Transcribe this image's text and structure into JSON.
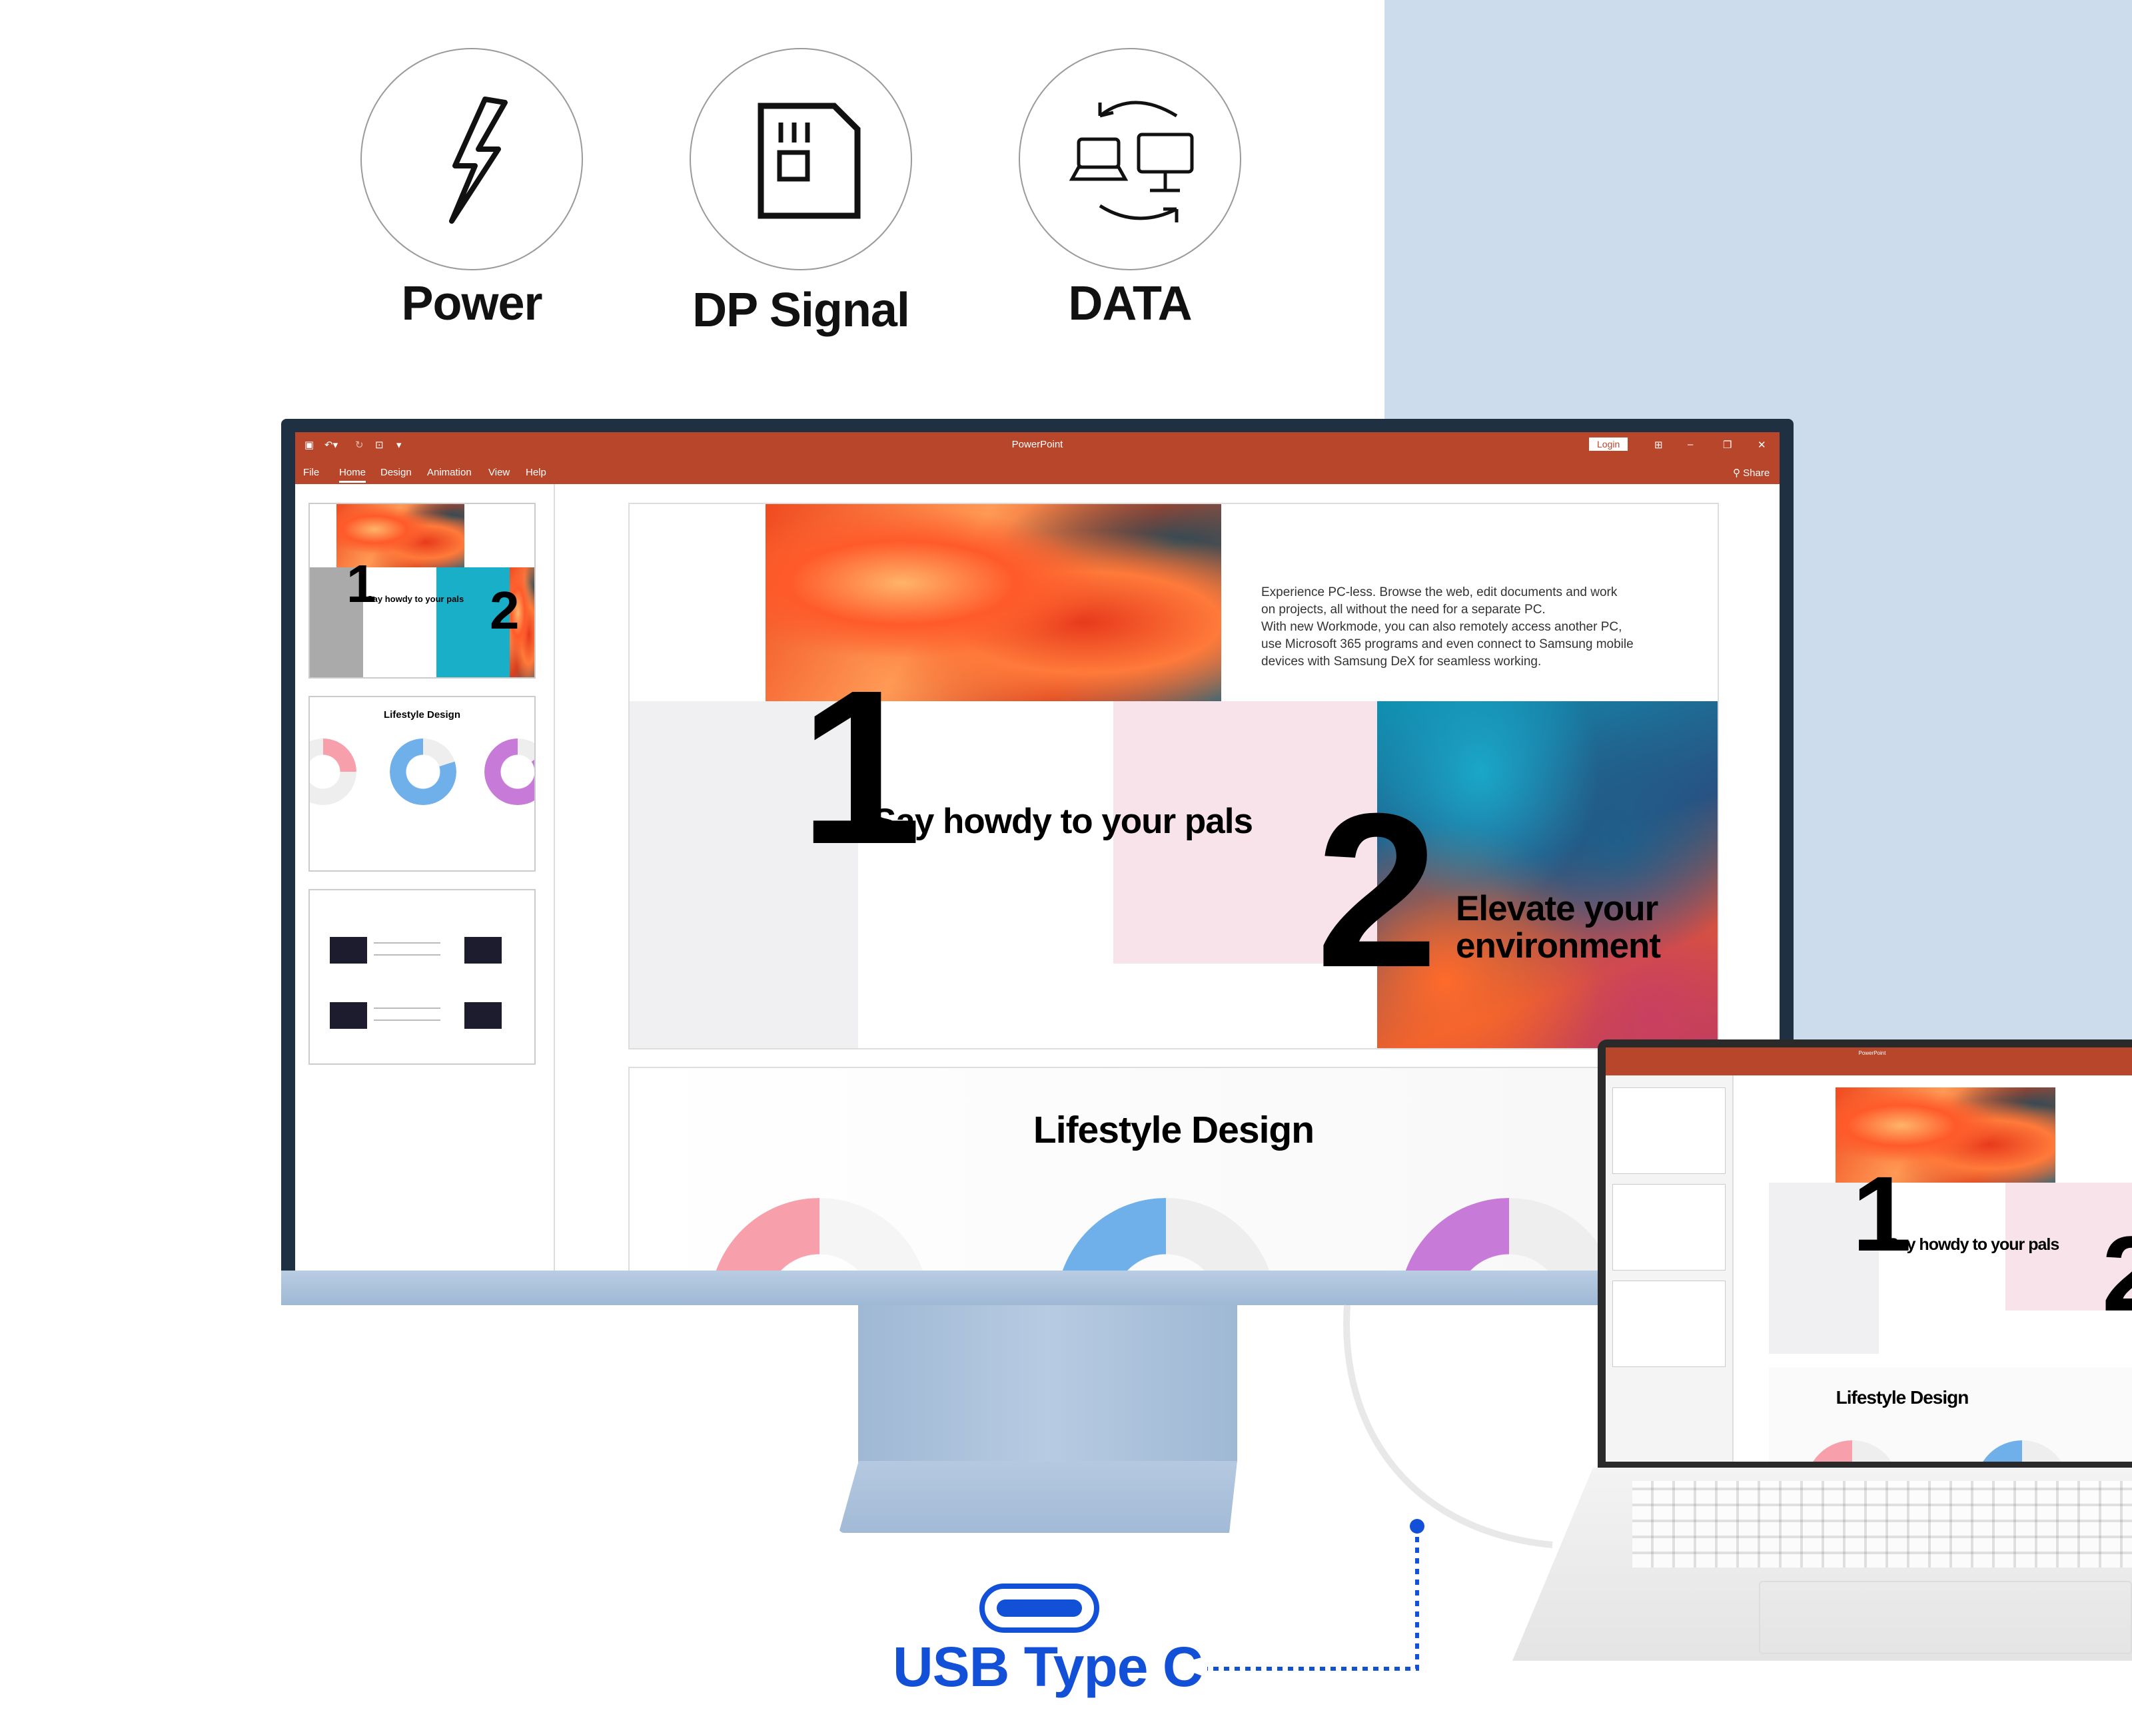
{
  "features": [
    {
      "label": "Power",
      "icon": "lightning-bolt-icon"
    },
    {
      "label": "DP Signal",
      "icon": "sd-card-icon"
    },
    {
      "label": "DATA",
      "icon": "device-sync-icon"
    }
  ],
  "app": {
    "title": "PowerPoint",
    "login_label": "Login",
    "share_label": "Share",
    "menu": [
      "File",
      "Home",
      "Design",
      "Animation",
      "View",
      "Help"
    ],
    "active_menu": "Home",
    "accent": "#b8462b"
  },
  "slide1": {
    "body": [
      "Experience PC-less. Browse the web, edit documents and work",
      "on projects, all without the need for a separate PC.",
      "With new Workmode, you can also remotely access another PC,",
      "use Microsoft 365 programs and even connect to Samsung mobile",
      "devices with Samsung DeX for seamless working."
    ],
    "num1": "1",
    "heading1": "Say howdy to your pals",
    "num2": "2",
    "heading2a": "Elevate your",
    "heading2b": "environment"
  },
  "slide2": {
    "title": "Lifestyle Design"
  },
  "usb": {
    "label": "USB Type C",
    "color": "#1350d8"
  }
}
